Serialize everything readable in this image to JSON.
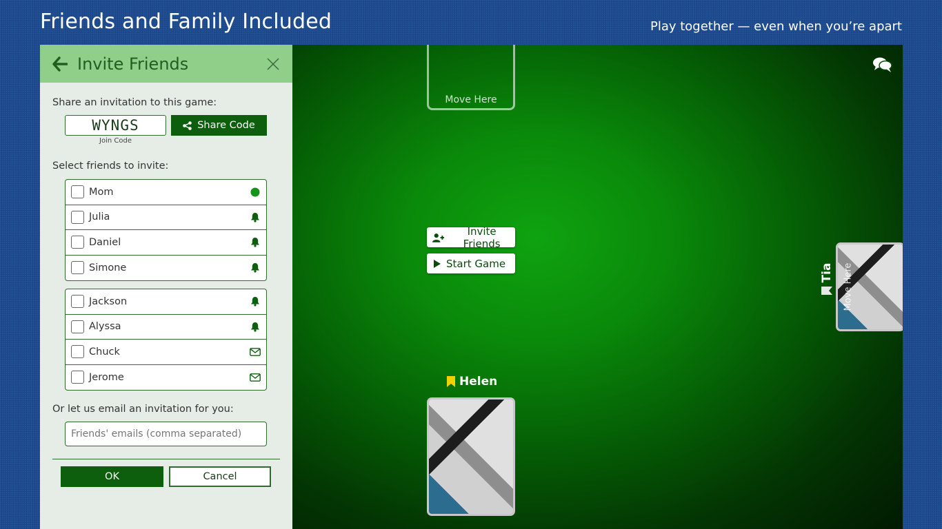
{
  "banner": {
    "title": "Friends and Family Included",
    "tagline": "Play together — even when you’re apart"
  },
  "panel": {
    "title": "Invite Friends",
    "share_label": "Share an invitation to this game:",
    "join_code": "WYNGS",
    "join_code_caption": "Join Code",
    "share_button": "Share Code",
    "select_label": "Select friends to invite:",
    "groups": [
      [
        {
          "name": "Mom",
          "status": "online-dot-icon"
        },
        {
          "name": "Julia",
          "status": "bell-icon"
        },
        {
          "name": "Daniel",
          "status": "bell-icon"
        },
        {
          "name": "Simone",
          "status": "bell-icon"
        }
      ],
      [
        {
          "name": "Jackson",
          "status": "bell-icon"
        },
        {
          "name": "Alyssa",
          "status": "bell-icon"
        },
        {
          "name": "Chuck",
          "status": "envelope-icon"
        },
        {
          "name": "Jerome",
          "status": "envelope-icon"
        }
      ]
    ],
    "email_label": "Or let us email an invitation for you:",
    "email_placeholder": "Friends' emails (comma separated)",
    "ok_button": "OK",
    "cancel_button": "Cancel"
  },
  "game": {
    "move_here_top": "Move Here",
    "move_here_right": "Move Here",
    "invite_button": "Invite Friends",
    "start_button": "Start Game",
    "player_bottom": "Helen",
    "player_right": "Tia"
  },
  "colors": {
    "accent_green": "#0d5f0d",
    "header_green": "#8fcf8a",
    "bookmark_yellow": "#f2d100",
    "background_blue": "#1c4a8e"
  }
}
